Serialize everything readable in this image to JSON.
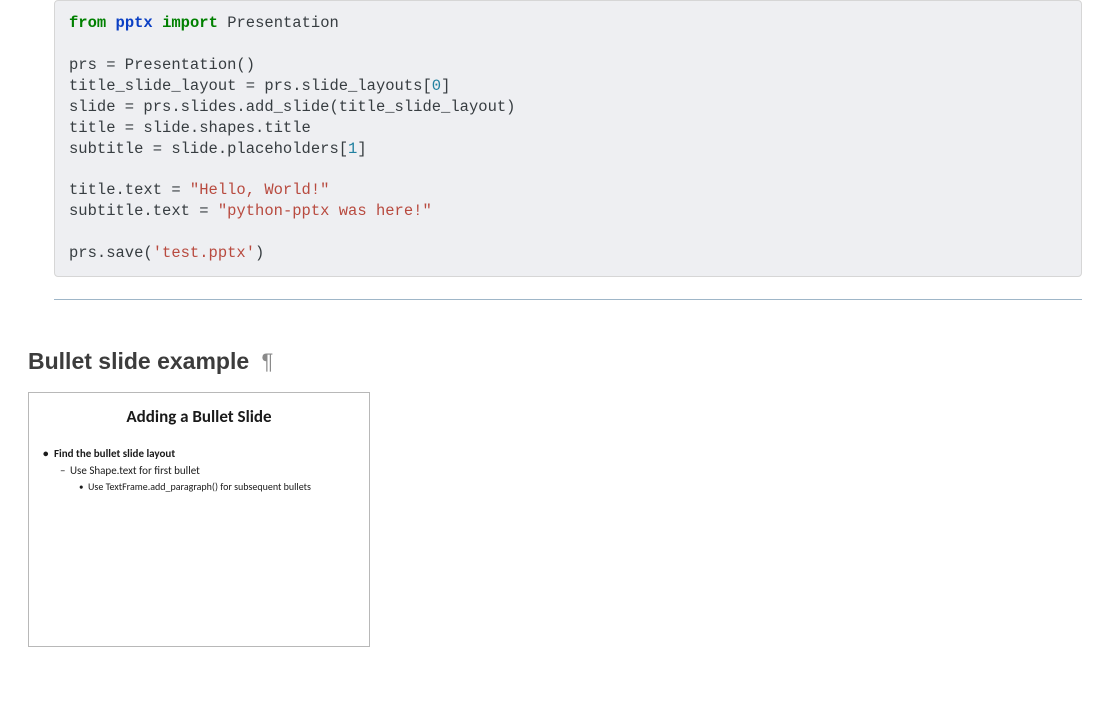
{
  "code": {
    "line1_from": "from",
    "line1_mod": "pptx",
    "line1_import": "import",
    "line1_obj": "Presentation",
    "line3": "prs = Presentation()",
    "line4_a": "title_slide_layout = prs.slide_layouts[",
    "line4_num": "0",
    "line4_b": "]",
    "line5": "slide = prs.slides.add_slide(title_slide_layout)",
    "line6": "title = slide.shapes.title",
    "line7_a": "subtitle = slide.placeholders[",
    "line7_num": "1",
    "line7_b": "]",
    "line9_a": "title.text = ",
    "line9_str": "\"Hello, World!\"",
    "line10_a": "subtitle.text = ",
    "line10_str": "\"python-pptx was here!\"",
    "line12_a": "prs.save(",
    "line12_str": "'test.pptx'",
    "line12_b": ")"
  },
  "section": {
    "heading": "Bullet slide example"
  },
  "slide_thumb": {
    "title": "Adding a Bullet Slide",
    "bullet_lvl0": "Find the bullet slide layout",
    "bullet_lvl1": "Use Shape.text for first bullet",
    "bullet_lvl2": "Use TextFrame.add_paragraph() for subsequent bullets"
  }
}
